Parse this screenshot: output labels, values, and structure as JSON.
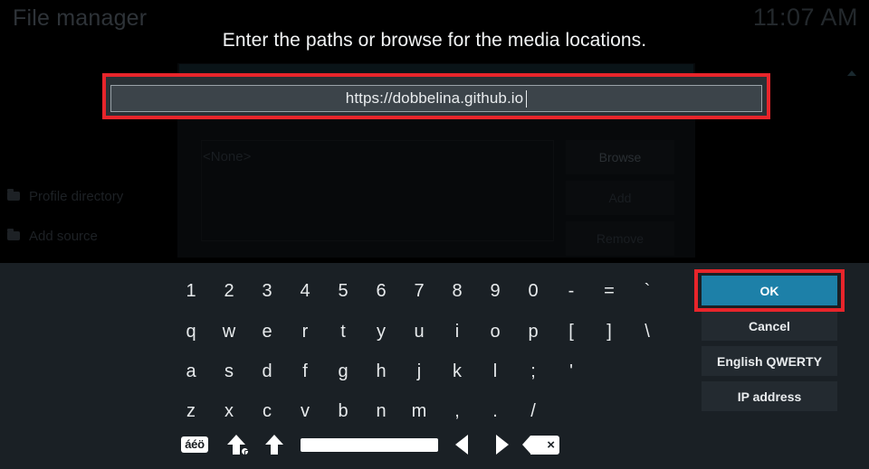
{
  "window": {
    "title": "File manager",
    "clock": "11:07 AM"
  },
  "sidebar": {
    "items": [
      {
        "label": "Profile directory",
        "icon": "folder-icon"
      },
      {
        "label": "Add source",
        "icon": "folder-icon"
      }
    ]
  },
  "background_dialog": {
    "list_placeholder": "<None>",
    "buttons": [
      {
        "label": "Browse"
      },
      {
        "label": "Add"
      },
      {
        "label": "Remove"
      }
    ]
  },
  "dialog": {
    "heading": "Enter the paths or browse for the media locations.",
    "input": {
      "value": "https://dobbelina.github.io",
      "placeholder": "",
      "has_caret": true
    }
  },
  "keyboard": {
    "rows": [
      [
        "1",
        "2",
        "3",
        "4",
        "5",
        "6",
        "7",
        "8",
        "9",
        "0",
        "-",
        "=",
        "`"
      ],
      [
        "q",
        "w",
        "e",
        "r",
        "t",
        "y",
        "u",
        "i",
        "o",
        "p",
        "[",
        "]",
        "\\"
      ],
      [
        "a",
        "s",
        "d",
        "f",
        "g",
        "h",
        "j",
        "k",
        "l",
        ";",
        "'"
      ],
      [
        "z",
        "x",
        "c",
        "v",
        "b",
        "n",
        "m",
        ",",
        ".",
        "/"
      ]
    ],
    "function_keys": [
      {
        "name": "symbols-key",
        "label": "áéö"
      },
      {
        "name": "caps-lock-key",
        "label": ""
      },
      {
        "name": "shift-key",
        "label": ""
      },
      {
        "name": "space-key",
        "label": ""
      },
      {
        "name": "cursor-left-key",
        "label": ""
      },
      {
        "name": "cursor-right-key",
        "label": ""
      },
      {
        "name": "backspace-key",
        "label": "×"
      }
    ]
  },
  "actions": {
    "buttons": [
      {
        "label": "OK",
        "focused": true
      },
      {
        "label": "Cancel",
        "focused": false
      },
      {
        "label": "English QWERTY",
        "focused": false
      },
      {
        "label": "IP address",
        "focused": false
      }
    ]
  },
  "colors": {
    "accent": "#1d80a8",
    "annotation": "#e8252b",
    "keyboard_bg": "#1a2025",
    "button_bg": "#232a30",
    "input_bg": "#3c444a"
  }
}
